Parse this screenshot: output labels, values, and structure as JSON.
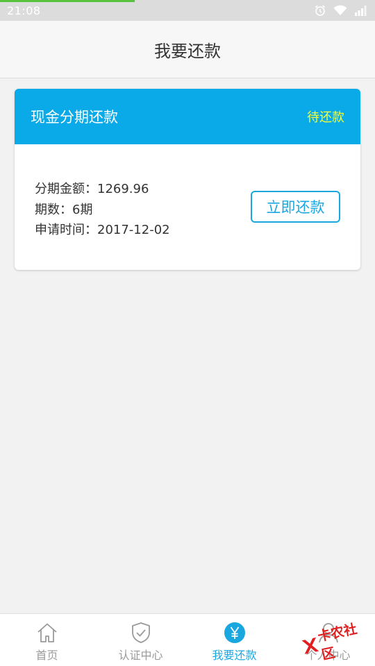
{
  "status_bar": {
    "time": "21:08",
    "icons": [
      "alarm-icon",
      "wifi-icon",
      "signal-icon"
    ]
  },
  "header": {
    "title": "我要还款"
  },
  "card": {
    "title": "现金分期还款",
    "status": "待还款",
    "amount_label": "分期金额：",
    "amount_value": "1269.96",
    "periods_label": "期数：",
    "periods_value": "6期",
    "date_label": "申请时间：",
    "date_value": "2017-12-02",
    "repay_button": "立即还款"
  },
  "nav": {
    "items": [
      {
        "label": "首页",
        "icon": "home-icon"
      },
      {
        "label": "认证中心",
        "icon": "shield-check-icon"
      },
      {
        "label": "我要还款",
        "icon": "yen-icon"
      },
      {
        "label": "个人中心",
        "icon": "user-icon"
      }
    ],
    "active_index": 2
  },
  "watermark": {
    "text": "卡农社区"
  },
  "colors": {
    "primary": "#0aa9e8",
    "accent_text": "#1aa7e0",
    "status_yellow": "#f3ff3a",
    "progress_green": "#56c43a"
  }
}
